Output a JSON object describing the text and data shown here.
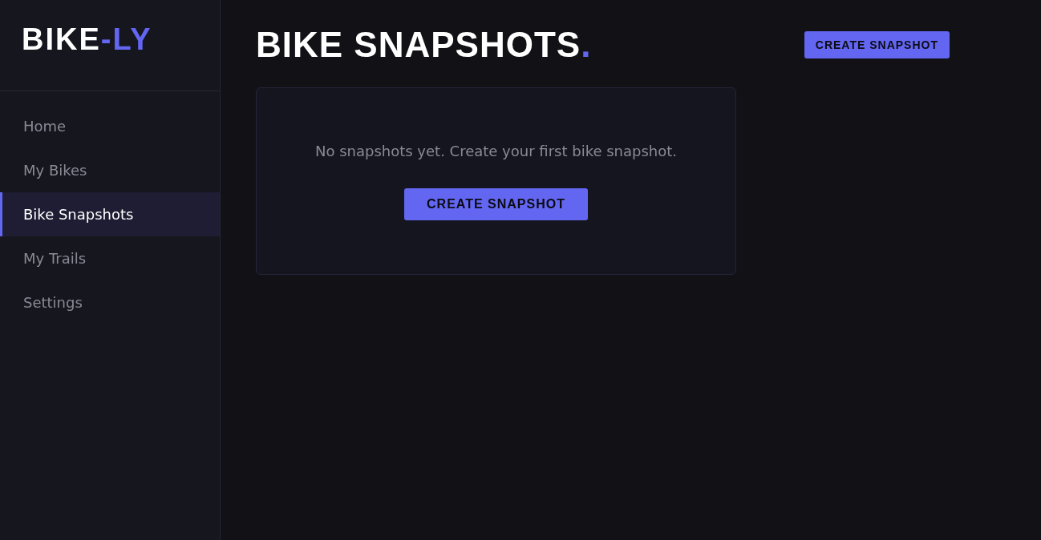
{
  "logo": {
    "text": "BIKE",
    "accent": "-LY"
  },
  "sidebar": {
    "items": [
      {
        "label": "Home",
        "selected": false
      },
      {
        "label": "My Bikes",
        "selected": false
      },
      {
        "label": "Bike Snapshots",
        "selected": true
      },
      {
        "label": "My Trails",
        "selected": false
      },
      {
        "label": "Settings",
        "selected": false
      }
    ]
  },
  "header": {
    "title": "BIKE SNAPSHOTS",
    "title_accent": ".",
    "button": "CREATE SNAPSHOT"
  },
  "empty_state": {
    "message": "No snapshots yet. Create your first bike snapshot.",
    "button": "CREATE SNAPSHOT"
  }
}
